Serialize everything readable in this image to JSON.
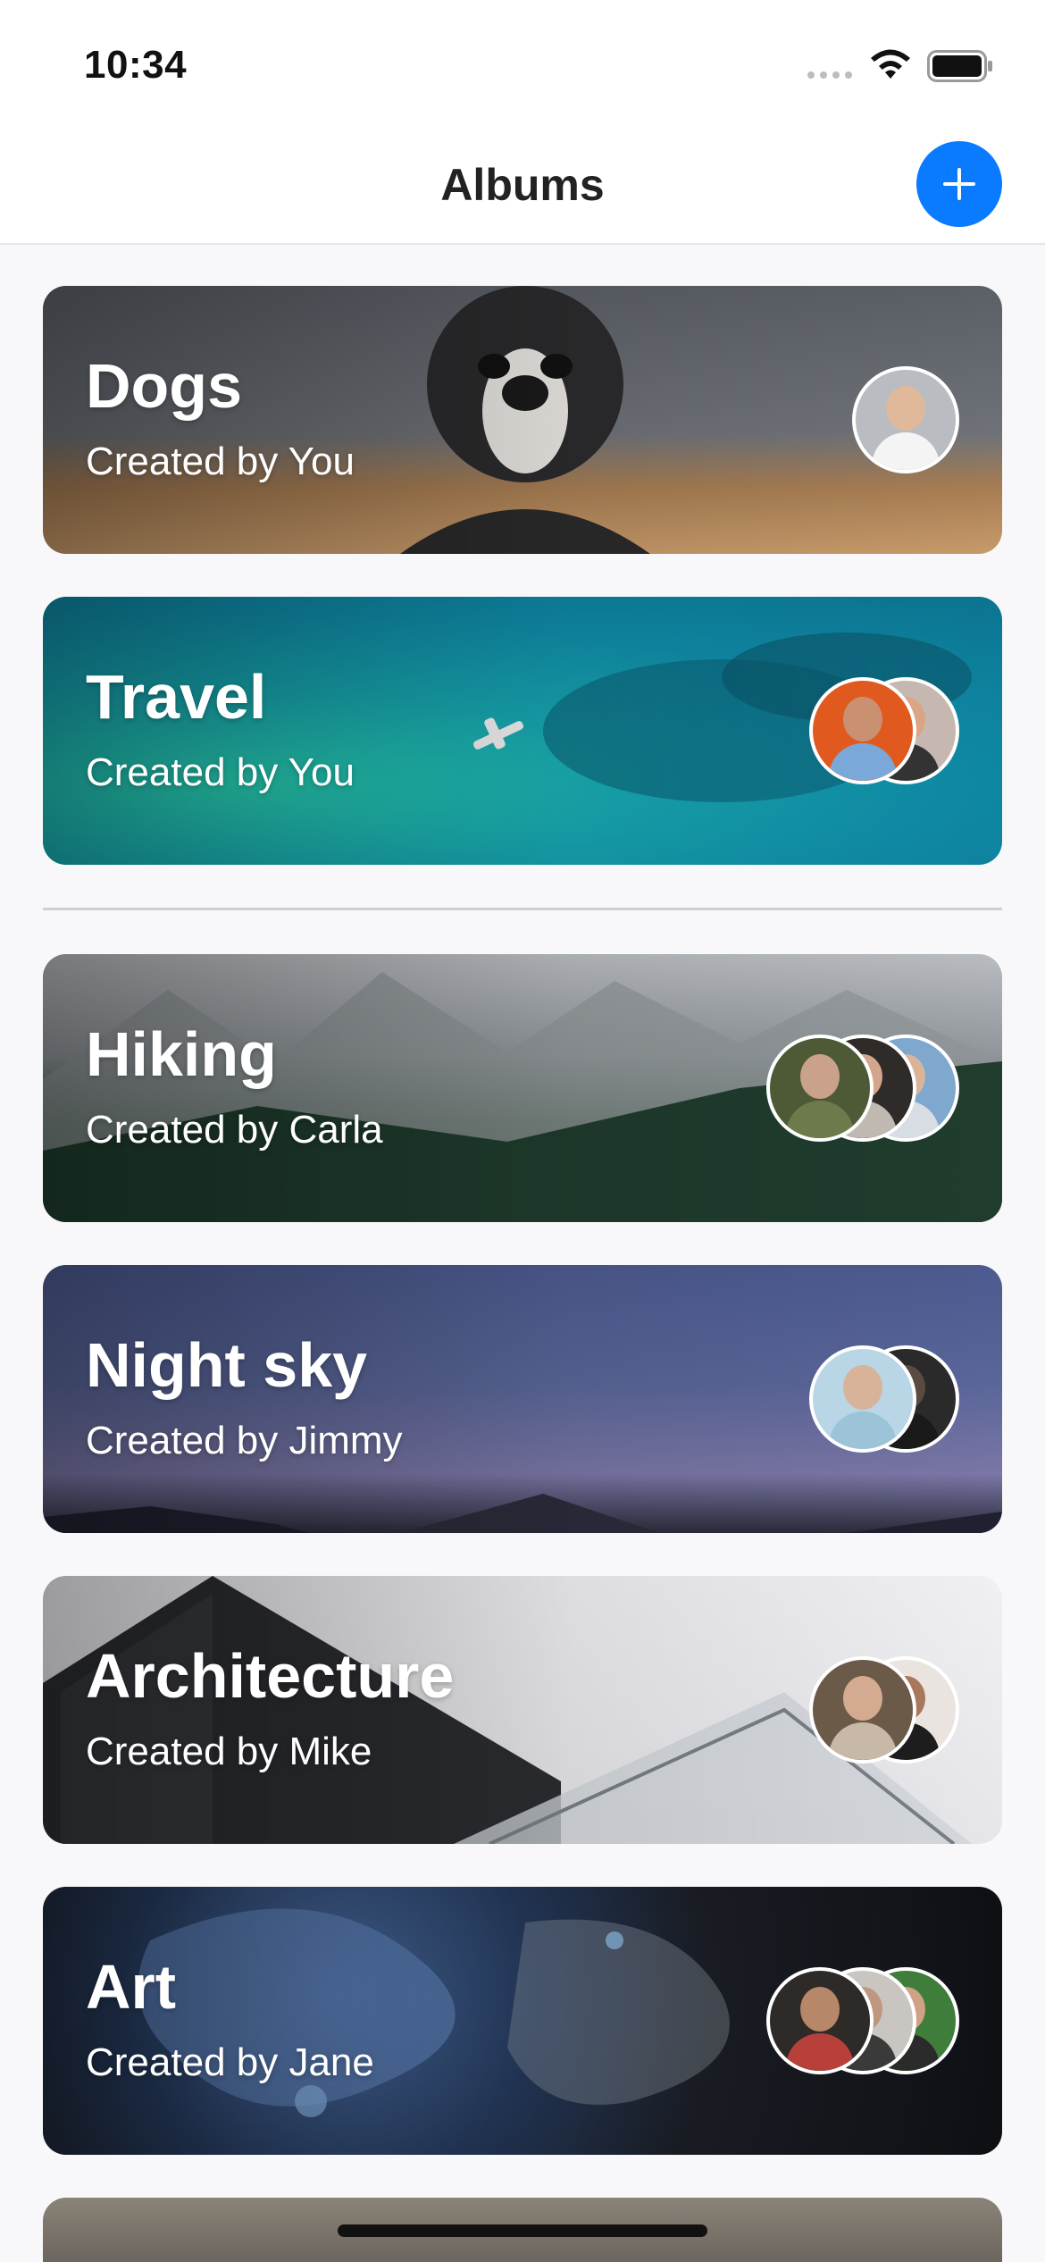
{
  "status_bar": {
    "time": "10:34"
  },
  "nav": {
    "title": "Albums"
  },
  "albums": [
    {
      "title": "Dogs",
      "subtitle": "Created by You"
    },
    {
      "title": "Travel",
      "subtitle": "Created by You"
    },
    {
      "title": "Hiking",
      "subtitle": "Created by Carla"
    },
    {
      "title": "Night sky",
      "subtitle": "Created by Jimmy"
    },
    {
      "title": "Architecture",
      "subtitle": "Created by Mike"
    },
    {
      "title": "Art",
      "subtitle": "Created by Jane"
    }
  ],
  "icons": {
    "add": "plus-icon",
    "wifi": "wifi-icon",
    "battery": "battery-icon",
    "signal": "cellular-signal-icon"
  },
  "colors": {
    "accent": "#0a7bff",
    "background": "#f8f8fa",
    "nav_background": "#ffffff"
  }
}
